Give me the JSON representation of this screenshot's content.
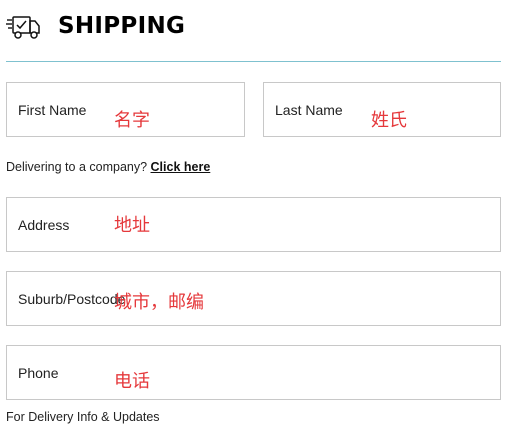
{
  "header": {
    "title": "SHIPPING",
    "icon": "truck-icon"
  },
  "fields": {
    "first_name": {
      "label": "First Name",
      "annotation": "名字"
    },
    "last_name": {
      "label": "Last Name",
      "annotation": "姓氏"
    },
    "address": {
      "label": "Address",
      "annotation": "地址"
    },
    "suburb": {
      "label": "Suburb/Postcode",
      "annotation": "城市，邮编"
    },
    "phone": {
      "label": "Phone",
      "annotation": "电话"
    }
  },
  "company": {
    "prompt": "Delivering to a company?",
    "link": "Click here"
  },
  "phone_helper": "For Delivery Info & Updates",
  "colors": {
    "divider": "#7fc1cf",
    "annotation": "#e5383b",
    "field_border": "#c8c8c8"
  }
}
